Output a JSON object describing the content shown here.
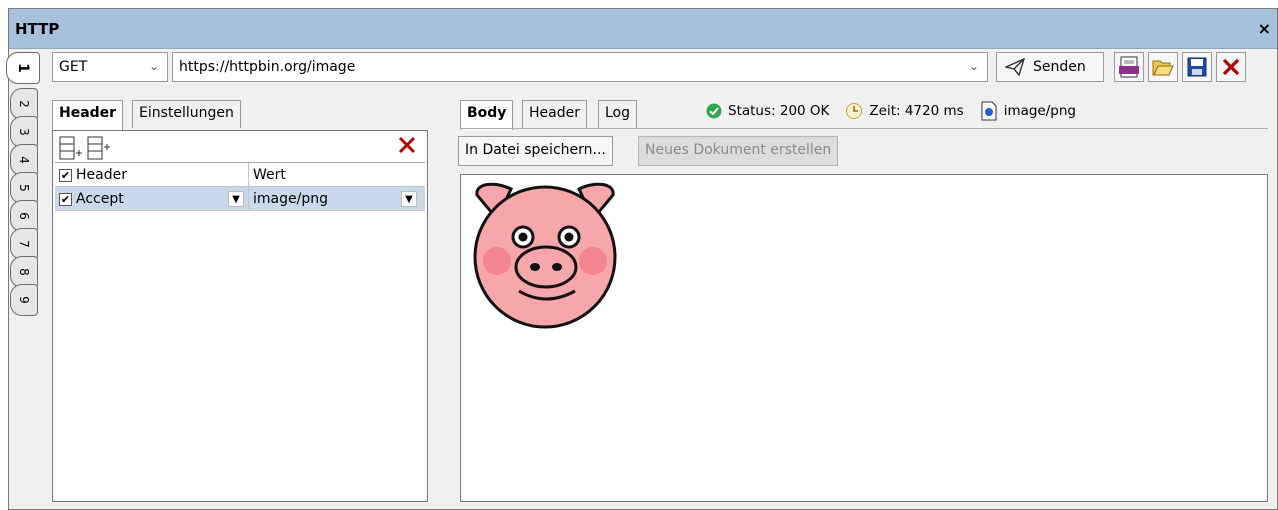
{
  "window": {
    "title": "HTTP",
    "close_label": "×"
  },
  "vertical_tabs": [
    "1",
    "2",
    "3",
    "4",
    "5",
    "6",
    "7",
    "8",
    "9"
  ],
  "request": {
    "method": "GET",
    "url": "https://httpbin.org/image",
    "send_label": "Senden"
  },
  "left_panel": {
    "tabs": [
      {
        "label": "Header",
        "active": true
      },
      {
        "label": "Einstellungen",
        "active": false
      }
    ],
    "columns": {
      "header": "Header",
      "value": "Wert"
    },
    "rows": [
      {
        "header": "Accept",
        "value": "image/png",
        "checked": true
      }
    ]
  },
  "right_panel": {
    "tabs": [
      {
        "label": "Body",
        "active": true
      },
      {
        "label": "Header",
        "active": false
      },
      {
        "label": "Log",
        "active": false
      }
    ],
    "status": "Status: 200 OK",
    "time": "Zeit: 4720 ms",
    "content_type": "image/png",
    "save_file_label": "In Datei speichern...",
    "new_document_label": "Neues Dokument erstellen"
  },
  "colors": {
    "titlebar": "#a7c0dc",
    "status_ok": "#2fa84f",
    "delete_red": "#b00000",
    "selected_row": "#c9d8ea"
  }
}
